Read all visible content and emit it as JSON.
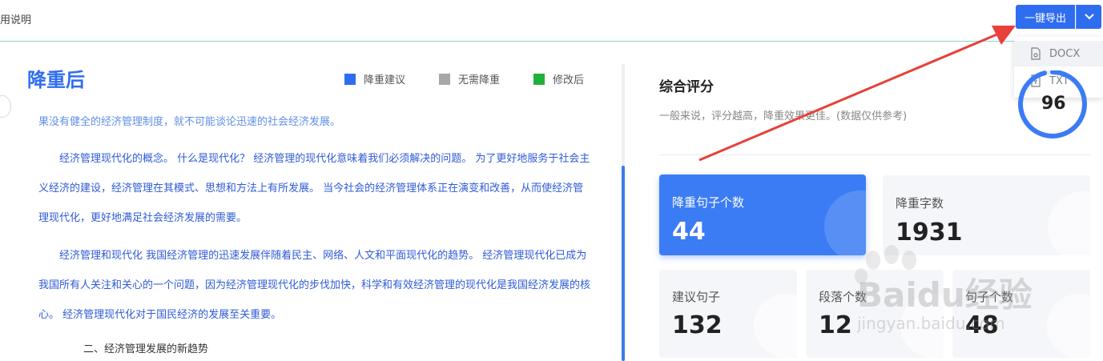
{
  "header": {
    "usage_label": "用说明",
    "export_label": "一键导出",
    "export_menu": [
      {
        "label": "DOCX",
        "icon": "docx-file-icon"
      },
      {
        "label": "TXT",
        "icon": "txt-file-icon"
      }
    ]
  },
  "left": {
    "title": "降重后",
    "legend": [
      {
        "label": "降重建议",
        "color": "#2f6df0"
      },
      {
        "label": "无需降重",
        "color": "#a8a8a8"
      },
      {
        "label": "修改后",
        "color": "#22b03c"
      }
    ],
    "paragraphs": [
      "果没有健全的经济管理制度，就不可能谈论迅速的社会经济发展。",
      "经济管理现代化的概念。 什么是现代化？ 经济管理的现代化意味着我们必须解决的问题。 为了更好地服务于社会主义经济的建设，经济管理在其模式、思想和方法上有所发展。 当今社会的经济管理体系正在演变和改善，从而使经济管理现代化，更好地满足社会经济发展的需要。",
      "经济管理和现代化 我国经济管理的迅速发展伴随着民主、网络、人文和平面现代化的趋势。 经济管理现代化已成为我国所有人关注和关心的一个问题，因为经济管理现代化的步伐加快，科学和有效经济管理的现代化是我国经济发展的核心。 经济管理现代化对于国民经济的发展至关重要。"
    ],
    "subheading": "二、经济管理发展的新趋势"
  },
  "right": {
    "score_title": "综合评分",
    "score_desc": "一般来说，评分越高，降重效果更佳。(数据仅供参考)",
    "score_value": "96",
    "score_fraction": 0.96,
    "cards": [
      {
        "label": "降重句子个数",
        "value": "44"
      },
      {
        "label": "降重字数",
        "value": "1931"
      },
      {
        "label": "建议句子",
        "value": "132"
      },
      {
        "label": "段落个数",
        "value": "12"
      },
      {
        "label": "句子个数",
        "value": "48"
      }
    ]
  },
  "watermark": {
    "text": "Baidu经验",
    "sub": "jingyan.baidu.com"
  },
  "colors": {
    "accent": "#2f6df0",
    "arrow": "#e8403a"
  }
}
